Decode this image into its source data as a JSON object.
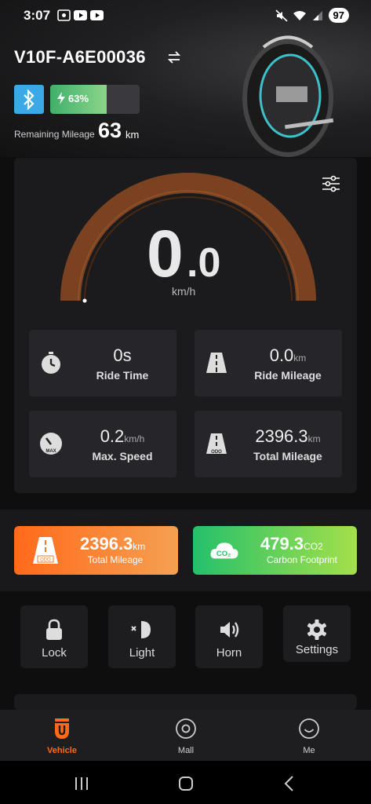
{
  "status_bar": {
    "time": "3:07",
    "battery": "97"
  },
  "header": {
    "vehicle_name": "V10F-A6E00036",
    "battery_percent_label": "63%",
    "battery_level": 0.63,
    "remaining_label": "Remaining Mileage",
    "remaining_value": "63",
    "remaining_unit": "km"
  },
  "gauge": {
    "speed_int": "0",
    "speed_dec": ".0",
    "unit": "km/h"
  },
  "stats": [
    {
      "value": "0s",
      "unit": "",
      "label": "Ride Time",
      "icon": "stopwatch-icon"
    },
    {
      "value": "0.0",
      "unit": "km",
      "label": "Ride Mileage",
      "icon": "road-icon"
    },
    {
      "value": "0.2",
      "unit": "km/h",
      "label": "Max. Speed",
      "icon": "speedometer-max-icon"
    },
    {
      "value": "2396.3",
      "unit": "km",
      "label": "Total Mileage",
      "icon": "road-odo-icon"
    }
  ],
  "summary": {
    "total_mileage": {
      "value": "2396.3",
      "unit": "km",
      "label": "Total Mileage",
      "icon_text": "ODO"
    },
    "carbon": {
      "value": "479.3",
      "unit": "CO2",
      "label": "Carbon Footprint",
      "icon_text": "CO₂"
    }
  },
  "controls": [
    {
      "label": "Lock",
      "icon": "lock-icon"
    },
    {
      "label": "Light",
      "icon": "light-icon"
    },
    {
      "label": "Horn",
      "icon": "horn-icon"
    },
    {
      "label": "Settings",
      "icon": "gear-icon"
    }
  ],
  "bottom_nav": [
    {
      "label": "Vehicle",
      "active": true
    },
    {
      "label": "Mall",
      "active": false
    },
    {
      "label": "Me",
      "active": false
    }
  ],
  "colors": {
    "accent_orange": "#ff6a1a",
    "bluetooth_blue": "#3aa9e6",
    "battery_green": "#3fb06a",
    "gauge_arc": "#8a4a22"
  }
}
